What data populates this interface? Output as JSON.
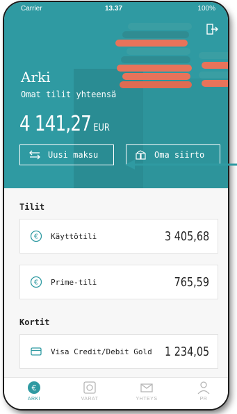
{
  "status_bar": {
    "carrier": "Carrier",
    "time": "13.37",
    "battery": "100%"
  },
  "header": {
    "title": "Arki",
    "subtitle": "Omat tilit yhteensä",
    "total_amount": "4 141,27",
    "currency": "EUR",
    "new_payment_label": "Uusi maksu",
    "own_transfer_label": "Oma siirto"
  },
  "accounts": {
    "section_title": "Tilit",
    "items": [
      {
        "name": "Käyttötili",
        "amount": "3 405,68"
      },
      {
        "name": "Prime-tili",
        "amount": "765,59"
      }
    ]
  },
  "cards": {
    "section_title": "Kortit",
    "items": [
      {
        "name": "Visa Credit/Debit Gold",
        "amount": "1 234,05"
      }
    ]
  },
  "tabbar": {
    "items": [
      {
        "label": "ARKI",
        "active": true,
        "icon": "euro-icon"
      },
      {
        "label": "VARAT",
        "active": false,
        "icon": "vault-icon"
      },
      {
        "label": "YHTEYS",
        "active": false,
        "icon": "mail-icon"
      },
      {
        "label": "PR",
        "active": false,
        "icon": "person-icon"
      }
    ]
  },
  "colors": {
    "teal": "#2f9aa2",
    "coin_orange": "#e8735a",
    "coin_teal": "#3fa5a9"
  }
}
